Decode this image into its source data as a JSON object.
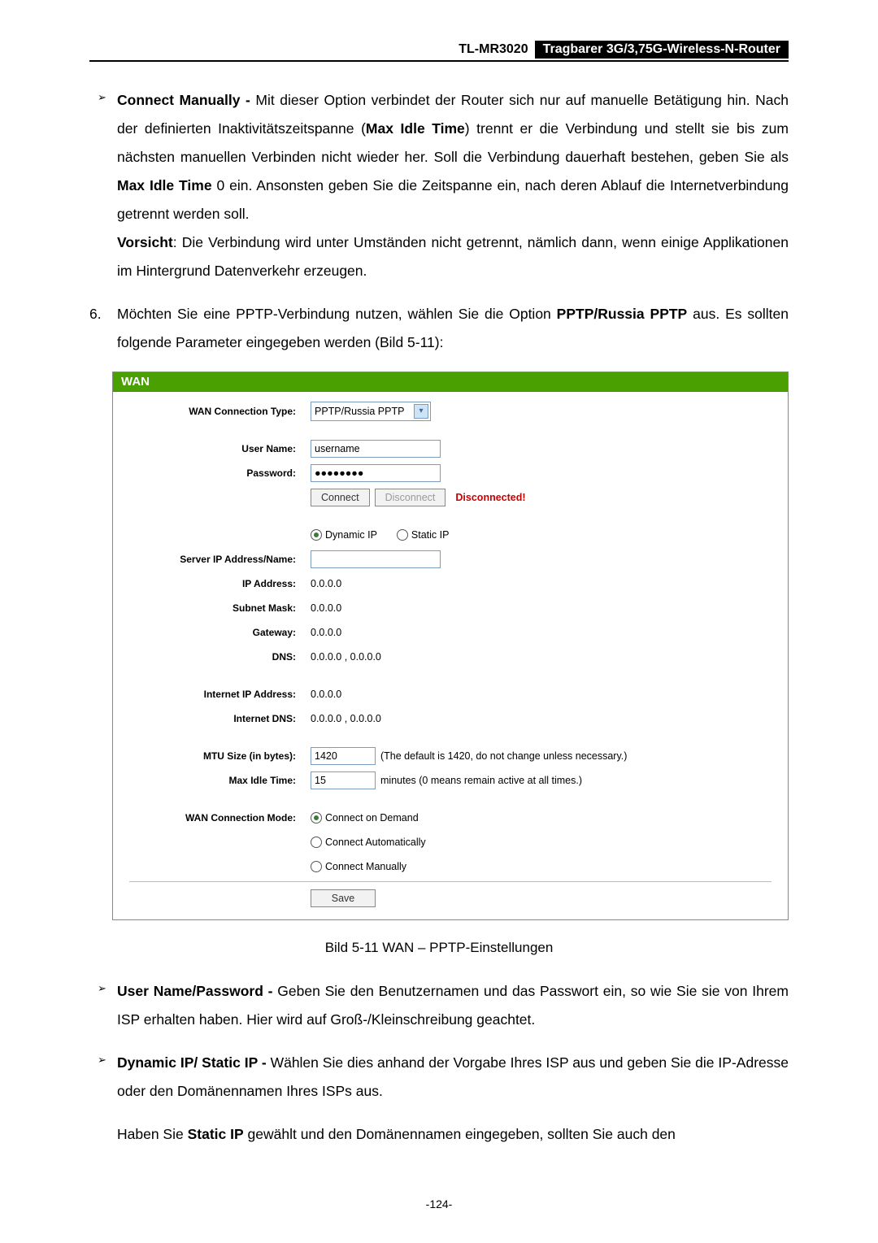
{
  "header": {
    "model": "TL-MR3020",
    "desc": "Tragbarer 3G/3,75G-Wireless-N-Router"
  },
  "bullet_connect_manually": {
    "title": "Connect Manually - ",
    "text1": "Mit dieser Option verbindet der Router sich nur auf manuelle Betätigung hin. Nach der definierten Inaktivitätszeitspanne (",
    "bold_idle": "Max Idle Time",
    "text2": ") trennt er die Verbindung und stellt sie bis zum nächsten manuellen Verbinden nicht wieder her. Soll die Verbindung dauerhaft bestehen, geben Sie als ",
    "text3": " 0 ein. Ansonsten geben Sie die Zeitspanne ein, nach deren Ablauf die Internetverbindung getrennt werden soll.",
    "warn_label": "Vorsicht",
    "warn_text": ": Die Verbindung wird unter Umständen nicht getrennt, nämlich dann, wenn einige Applikationen im Hintergrund Datenverkehr erzeugen."
  },
  "numbered": {
    "num": "6.",
    "text1": "Möchten Sie eine PPTP-Verbindung nutzen, wählen Sie die Option ",
    "bold": "PPTP/Russia PPTP",
    "text2": " aus. Es sollten folgende Parameter eingegeben werden (Bild 5-11):"
  },
  "fig": {
    "title": "WAN",
    "labels": {
      "conn_type": "WAN Connection Type:",
      "user": "User Name:",
      "pass": "Password:",
      "server": "Server IP Address/Name:",
      "ip": "IP Address:",
      "mask": "Subnet Mask:",
      "gw": "Gateway:",
      "dns": "DNS:",
      "inet_ip": "Internet IP Address:",
      "inet_dns": "Internet DNS:",
      "mtu": "MTU Size (in bytes):",
      "idle": "Max Idle Time:",
      "mode": "WAN Connection Mode:"
    },
    "values": {
      "conn_type": "PPTP/Russia PPTP",
      "user": "username",
      "pass": "●●●●●●●●",
      "connect": "Connect",
      "disconnect": "Disconnect",
      "status": "Disconnected!",
      "dyn_ip": "Dynamic IP",
      "stat_ip": "Static IP",
      "server": "",
      "ip": "0.0.0.0",
      "mask": "0.0.0.0",
      "gw": "0.0.0.0",
      "dns": "0.0.0.0 , 0.0.0.0",
      "inet_ip": "0.0.0.0",
      "inet_dns": "0.0.0.0 , 0.0.0.0",
      "mtu": "1420",
      "mtu_note": "(The default is 1420, do not change unless necessary.)",
      "idle": "15",
      "idle_note": "minutes (0 means remain active at all times.)",
      "mode_demand": "Connect on Demand",
      "mode_auto": "Connect Automatically",
      "mode_manual": "Connect Manually",
      "save": "Save"
    }
  },
  "caption": "Bild 5-11 WAN – PPTP-Einstellungen",
  "bullet_userpass": {
    "title": "User Name/Password - ",
    "text": "Geben Sie den Benutzernamen und das Passwort ein, so wie Sie sie von Ihrem ISP erhalten haben. Hier wird auf Groß-/Kleinschreibung geachtet."
  },
  "bullet_dynstat": {
    "title": "Dynamic IP/ Static IP - ",
    "text": "Wählen Sie dies anhand der Vorgabe Ihres ISP aus und geben Sie die IP-Adresse oder den Domänennamen Ihres ISPs aus."
  },
  "para_static": {
    "t1": "Haben Sie ",
    "b": "Static IP",
    "t2": " gewählt und den Domänennamen eingegeben, sollten Sie auch den"
  },
  "pagenum": "-124-"
}
